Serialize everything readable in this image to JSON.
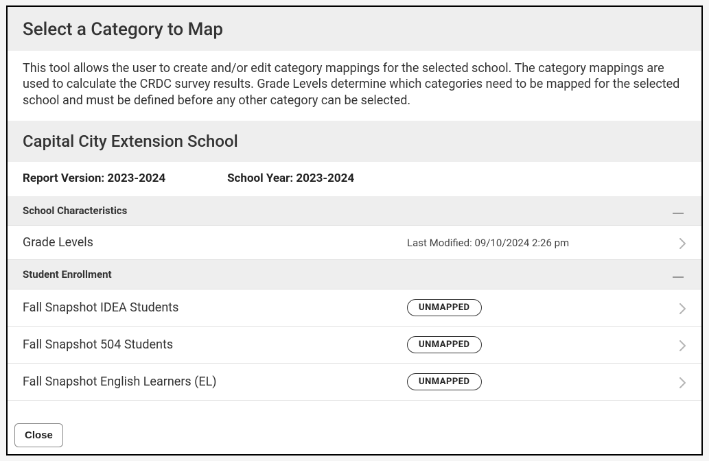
{
  "header": {
    "title": "Select a Category to Map"
  },
  "description": "This tool allows the user to create and/or edit category mappings for the selected school. The category mappings are used to calculate the CRDC survey results. Grade Levels determine which categories need to be mapped for the selected school and must be defined before any other category can be selected.",
  "school": {
    "name": "Capital City Extension School"
  },
  "meta": {
    "report_version_label": "Report Version: 2023-2024",
    "school_year_label": "School Year: 2023-2024"
  },
  "sections": {
    "school_characteristics": {
      "title": "School Characteristics",
      "rows": {
        "grade_levels": {
          "label": "Grade Levels",
          "last_modified": "Last Modified: 09/10/2024 2:26 pm"
        }
      }
    },
    "student_enrollment": {
      "title": "Student Enrollment",
      "rows": {
        "idea": {
          "label": "Fall Snapshot IDEA Students",
          "badge": "UNMAPPED"
        },
        "s504": {
          "label": "Fall Snapshot 504 Students",
          "badge": "UNMAPPED"
        },
        "el": {
          "label": "Fall Snapshot English Learners (EL)",
          "badge": "UNMAPPED"
        }
      }
    }
  },
  "footer": {
    "close_label": "Close"
  }
}
